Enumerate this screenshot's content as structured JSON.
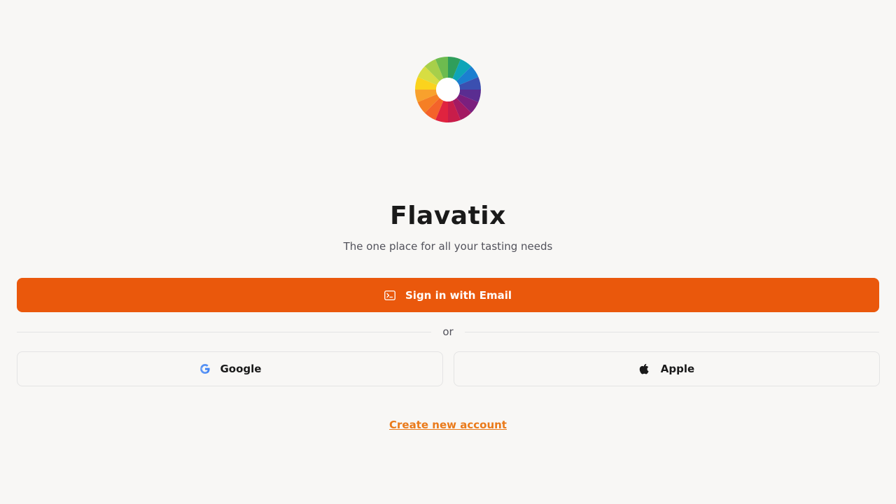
{
  "app": {
    "title": "Flavatix",
    "tagline": "The one place for all your tasting needs"
  },
  "logo": {
    "icon": "color-wheel-logo",
    "colors": [
      "#e0233f",
      "#f4632a",
      "#f57f25",
      "#f8a12d",
      "#fbd31d",
      "#d7dd42",
      "#a7cf4a",
      "#6dbb4f",
      "#2f9e5b",
      "#0ea5b8",
      "#1b7fd0",
      "#3b4fb0",
      "#5a2d91",
      "#7b1f7e",
      "#a31a63",
      "#c81d4a"
    ]
  },
  "auth": {
    "email_button_label": "Sign in with Email",
    "email_icon": "terminal-icon",
    "divider_label": "or",
    "google_label": "Google",
    "google_icon": "google-icon",
    "apple_label": "Apple",
    "apple_icon": "apple-icon",
    "create_account_label": "Create new account"
  },
  "colors": {
    "accent": "#ea580c",
    "link": "#ea7a1a",
    "background": "#f8f7f5"
  }
}
